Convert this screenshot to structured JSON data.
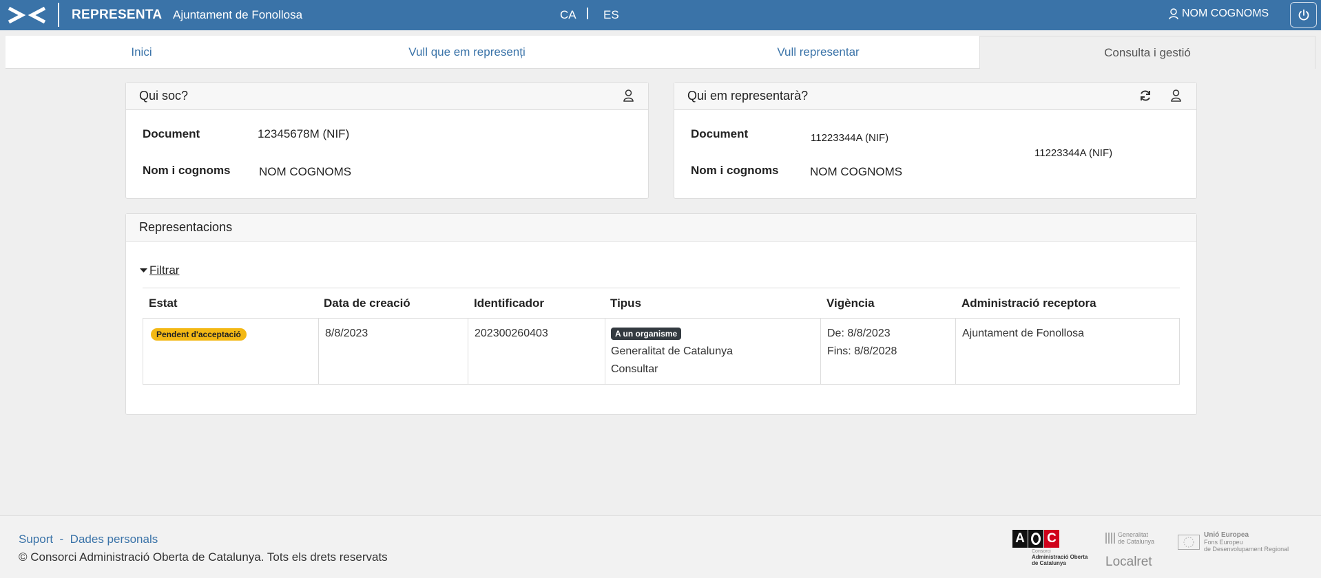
{
  "topbar": {
    "app_name": "REPRESENTA",
    "org_name": "Ajuntament de Fonollosa",
    "lang_ca": "CA",
    "lang_es": "ES",
    "user_name": "NOM COGNOMS"
  },
  "tabs": [
    {
      "label": "Inici"
    },
    {
      "label": "Vull que em represenți"
    },
    {
      "label": "Vull representar"
    },
    {
      "label": "Consulta i gestió"
    }
  ],
  "who_am_i": {
    "title": "Qui soc?",
    "document_label": "Document",
    "document_value": "12345678M (NIF)",
    "name_label": "Nom i cognoms",
    "name_value": "NOM COGNOMS"
  },
  "who_represents": {
    "title": "Qui em representarà?",
    "document_label": "Document",
    "document_value": "11223344A (NIF)",
    "document_value_2": "11223344A (NIF)",
    "name_label": "Nom i cognoms",
    "name_value": "NOM COGNOMS"
  },
  "representations": {
    "title": "Representacions",
    "filter_label": "Filtrar",
    "columns": [
      "Estat",
      "Data de creació",
      "Identificador",
      "Tipus",
      "Vigència",
      "Administració receptora"
    ],
    "rows": [
      {
        "status": "Pendent d'acceptació",
        "created": "8/8/2023",
        "id": "202300260403",
        "type_badge": "A un organisme",
        "type_org": "Generalitat de Catalunya",
        "type_action": "Consultar",
        "valid_from": "De: 8/8/2023",
        "valid_to": "Fins: 8/8/2028",
        "receiver": "Ajuntament de Fonollosa"
      }
    ]
  },
  "footer": {
    "link_support": "Suport",
    "link_separator": "-",
    "link_personal": "Dades personals",
    "copyright": "© Consorci Administració Oberta de Catalunya. Tots els drets reservats",
    "logo_aoc": "AOC",
    "logo_aoc_caption_1": "Consorci",
    "logo_aoc_caption_2": "Administració Oberta",
    "logo_aoc_caption_3": "de Catalunya",
    "logo_gen_1": "Generalitat",
    "logo_gen_2": "de Catalunya",
    "logo_localret": "Localret",
    "logo_eu_1": "Unió Europea",
    "logo_eu_2": "Fons Europeu",
    "logo_eu_3": "de Desenvolupament Regional"
  },
  "colors": {
    "primary": "#3a73a8",
    "badge_warning": "#f3b814",
    "badge_dark": "#333a40"
  }
}
